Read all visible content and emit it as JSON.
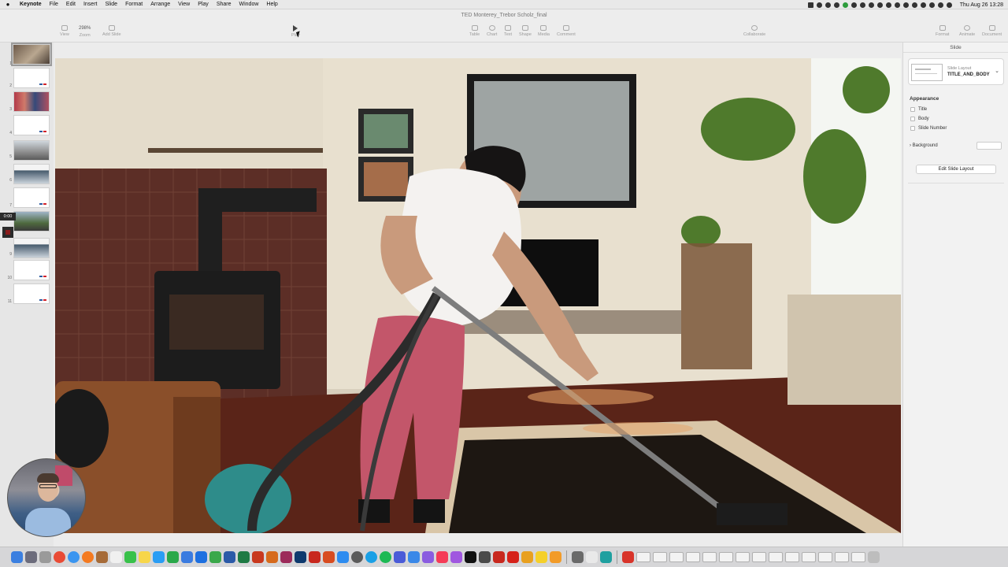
{
  "menubar": {
    "app": "Keynote",
    "items": [
      "File",
      "Edit",
      "Insert",
      "Slide",
      "Format",
      "Arrange",
      "View",
      "Play",
      "Share",
      "Window",
      "Help"
    ],
    "clock": "Thu Aug 26  13:28"
  },
  "window": {
    "title": "TED Monterey_Trebor Scholz_final"
  },
  "toolbar": {
    "zoom_value": "298%",
    "view_label": "View",
    "zoom_label": "Zoom",
    "add_slide_label": "Add Slide",
    "play_label": "Play",
    "table_label": "Table",
    "chart_label": "Chart",
    "text_label": "Text",
    "shape_label": "Shape",
    "media_label": "Media",
    "comment_label": "Comment",
    "collaborate_label": "Collaborate",
    "format_label": "Format",
    "animate_label": "Animate",
    "document_label": "Document"
  },
  "navigator": {
    "slide_numbers": [
      "1",
      "2",
      "3",
      "4",
      "5",
      "6",
      "7",
      "8",
      "9",
      "10",
      "11"
    ],
    "timer": "0:00"
  },
  "inspector": {
    "header": "Slide",
    "layout_label": "Slide Layout",
    "layout_value": "TITLE_AND_BODY",
    "appearance_title": "Appearance",
    "title_option": "Title",
    "body_option": "Body",
    "slide_number_option": "Slide Number",
    "background_label": "Background",
    "edit_layout_button": "Edit Slide Layout"
  },
  "colors": {
    "accent_red": "#d0232b",
    "accent_blue": "#2c5aa0"
  }
}
